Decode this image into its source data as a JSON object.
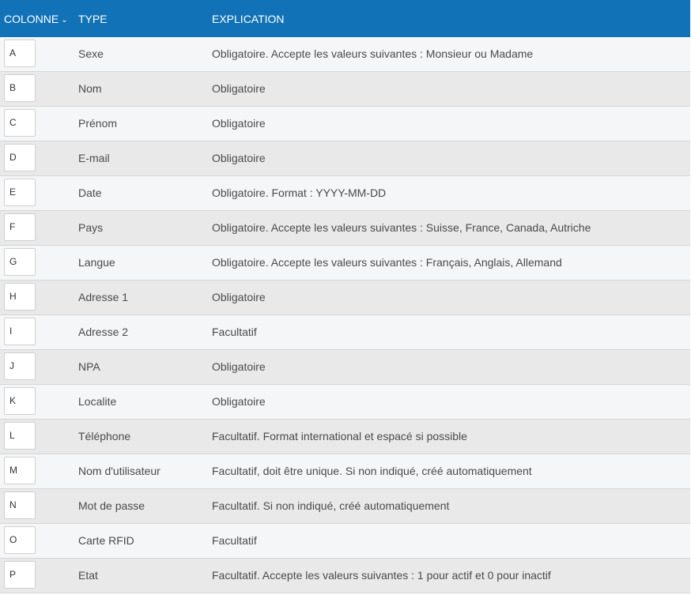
{
  "header": {
    "col_colonne": "COLONNE",
    "col_type": "TYPE",
    "col_explication": "EXPLICATION",
    "sort_icon": "chevron-down-icon",
    "bg_color": "#1172b7"
  },
  "rows": [
    {
      "col": "A",
      "type": "Sexe",
      "explication": "Obligatoire. Accepte les valeurs suivantes : Monsieur ou Madame"
    },
    {
      "col": "B",
      "type": "Nom",
      "explication": "Obligatoire"
    },
    {
      "col": "C",
      "type": "Prénom",
      "explication": "Obligatoire"
    },
    {
      "col": "D",
      "type": "E-mail",
      "explication": "Obligatoire"
    },
    {
      "col": "E",
      "type": "Date",
      "explication": "Obligatoire. Format : YYYY-MM-DD"
    },
    {
      "col": "F",
      "type": "Pays",
      "explication": "Obligatoire. Accepte les valeurs suivantes : Suisse, France, Canada, Autriche"
    },
    {
      "col": "G",
      "type": "Langue",
      "explication": "Obligatoire. Accepte les valeurs suivantes : Français, Anglais, Allemand"
    },
    {
      "col": "H",
      "type": "Adresse 1",
      "explication": "Obligatoire"
    },
    {
      "col": "I",
      "type": "Adresse 2",
      "explication": "Facultatif"
    },
    {
      "col": "J",
      "type": "NPA",
      "explication": "Obligatoire"
    },
    {
      "col": "K",
      "type": "Localite",
      "explication": "Obligatoire"
    },
    {
      "col": "L",
      "type": "Téléphone",
      "explication": "Facultatif. Format international et espacé si possible"
    },
    {
      "col": "M",
      "type": "Nom d'utilisateur",
      "explication": "Facultatif, doit être unique. Si non indiqué, créé automatiquement"
    },
    {
      "col": "N",
      "type": "Mot de passe",
      "explication": "Facultatif. Si non indiqué, créé automatiquement"
    },
    {
      "col": "O",
      "type": "Carte RFID",
      "explication": "Facultatif"
    },
    {
      "col": "P",
      "type": "Etat",
      "explication": "Facultatif. Accepte les valeurs suivantes : 1 pour actif et 0 pour inactif"
    }
  ]
}
